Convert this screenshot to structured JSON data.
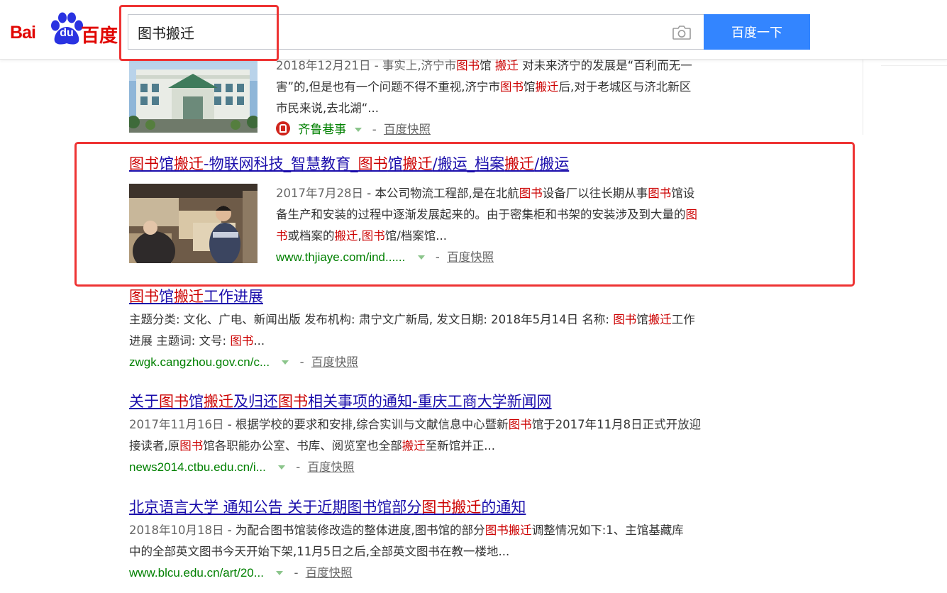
{
  "header": {
    "logo": {
      "latin_left": "Bai",
      "paw_text": "du",
      "cn_text": "百度"
    },
    "search": {
      "query": "图书搬迁",
      "button_label": "百度一下"
    }
  },
  "results": [
    {
      "abstract": [
        {
          "t": "2018年12月21日 - 事实上,济宁市",
          "c": "date"
        },
        {
          "t": "图书",
          "c": "hl"
        },
        {
          "t": "馆 "
        },
        {
          "t": "搬迁",
          "c": "hl"
        },
        {
          "t": " 对未来济宁的发展是“百利而无一害”的,但是也有一个问题不得不重视,济宁市"
        },
        {
          "t": "图书",
          "c": "hl"
        },
        {
          "t": "馆"
        },
        {
          "t": "搬迁",
          "c": "hl"
        },
        {
          "t": "后,对于老城区与济北新区市民来说,去北湖“..."
        }
      ],
      "source_name": "齐鲁巷事",
      "kuaizhao": "百度快照"
    },
    {
      "title": [
        {
          "t": "图书",
          "c": "hl"
        },
        {
          "t": "馆"
        },
        {
          "t": "搬迁",
          "c": "hl"
        },
        {
          "t": "-物联网科技_智慧教育_"
        },
        {
          "t": "图书",
          "c": "hl"
        },
        {
          "t": "馆"
        },
        {
          "t": "搬迁",
          "c": "hl"
        },
        {
          "t": "/搬运_档案"
        },
        {
          "t": "搬迁",
          "c": "hl"
        },
        {
          "t": "/搬运"
        }
      ],
      "abstract": [
        {
          "t": "2017年7月28日",
          "c": "date"
        },
        {
          "t": " - 本公司物流工程部,是在北航"
        },
        {
          "t": "图书",
          "c": "hl"
        },
        {
          "t": "设备厂以往长期从事"
        },
        {
          "t": "图书",
          "c": "hl"
        },
        {
          "t": "馆设备生产和安装的过程中逐渐发展起来的。由于密集柜和书架的安装涉及到大量的"
        },
        {
          "t": "图书",
          "c": "hl"
        },
        {
          "t": "或档案的"
        },
        {
          "t": "搬迁",
          "c": "hl"
        },
        {
          "t": ","
        },
        {
          "t": "图书",
          "c": "hl"
        },
        {
          "t": "馆/档案馆..."
        }
      ],
      "url": "www.thjiaye.com/ind......",
      "kuaizhao": "百度快照"
    },
    {
      "title": [
        {
          "t": "图书",
          "c": "hl"
        },
        {
          "t": "馆"
        },
        {
          "t": "搬迁",
          "c": "hl"
        },
        {
          "t": "工作进展"
        }
      ],
      "abstract": [
        {
          "t": "主题分类: 文化、广电、新闻出版 发布机构: 肃宁文广新局, 发文日期: 2018年5月14日 名称: "
        },
        {
          "t": "图书",
          "c": "hl"
        },
        {
          "t": "馆"
        },
        {
          "t": "搬迁",
          "c": "hl"
        },
        {
          "t": "工作进展 主题词: 文号: "
        },
        {
          "t": "图书",
          "c": "hl"
        },
        {
          "t": "..."
        }
      ],
      "url": "zwgk.cangzhou.gov.cn/c...",
      "kuaizhao": "百度快照"
    },
    {
      "title": [
        {
          "t": "关于"
        },
        {
          "t": "图书",
          "c": "hl"
        },
        {
          "t": "馆"
        },
        {
          "t": "搬迁",
          "c": "hl"
        },
        {
          "t": "及归还"
        },
        {
          "t": "图书",
          "c": "hl"
        },
        {
          "t": "相关事项的通知-重庆工商大学新闻网"
        }
      ],
      "abstract": [
        {
          "t": "2017年11月16日",
          "c": "date"
        },
        {
          "t": " - 根据学校的要求和安排,综合实训与文献信息中心暨新"
        },
        {
          "t": "图书",
          "c": "hl"
        },
        {
          "t": "馆于2017年11月8日正式开放迎接读者,原"
        },
        {
          "t": "图书",
          "c": "hl"
        },
        {
          "t": "馆各职能办公室、书库、阅览室也全部"
        },
        {
          "t": "搬迁",
          "c": "hl"
        },
        {
          "t": "至新馆并正..."
        }
      ],
      "url": "news2014.ctbu.edu.cn/i...",
      "kuaizhao": "百度快照"
    },
    {
      "title": [
        {
          "t": "北京语言大学 通知公告 关于近期图书馆部分"
        },
        {
          "t": "图书搬迁",
          "c": "hl"
        },
        {
          "t": "的通知"
        }
      ],
      "abstract": [
        {
          "t": "2018年10月18日",
          "c": "date"
        },
        {
          "t": " - 为配合图书馆装修改造的整体进度,图书馆的部分"
        },
        {
          "t": "图书搬迁",
          "c": "hl"
        },
        {
          "t": "调整情况如下:1、主馆基藏库中的全部英文图书今天开始下架,11月5日之后,全部英文图书在教一楼地..."
        }
      ],
      "url": "www.blcu.edu.cn/art/20...",
      "kuaizhao": "百度快照"
    }
  ]
}
